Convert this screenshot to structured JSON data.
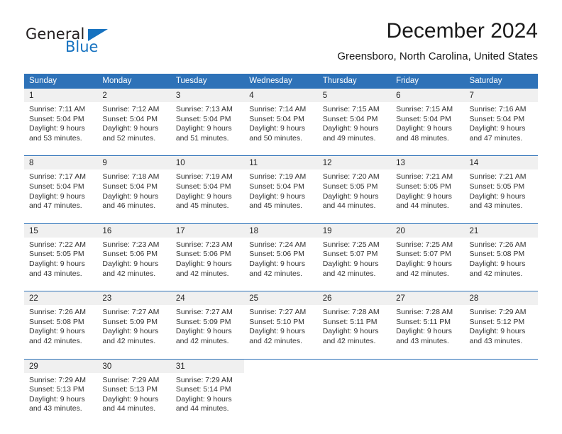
{
  "brand": {
    "name_top": "General",
    "name_bottom": "Blue",
    "triangle_icon": "triangle-icon",
    "color_blue": "#1672c0",
    "color_dark": "#231f20"
  },
  "header": {
    "title": "December 2024",
    "subtitle": "Greensboro, North Carolina, United States"
  },
  "theme": {
    "header_blue": "#2e72b8",
    "day_band_gray": "#f0f0f0",
    "text_color": "#222222"
  },
  "weekdays": [
    "Sunday",
    "Monday",
    "Tuesday",
    "Wednesday",
    "Thursday",
    "Friday",
    "Saturday"
  ],
  "weeks": [
    [
      {
        "day": "1",
        "sunrise": "Sunrise: 7:11 AM",
        "sunset": "Sunset: 5:04 PM",
        "daylight_1": "Daylight: 9 hours",
        "daylight_2": "and 53 minutes."
      },
      {
        "day": "2",
        "sunrise": "Sunrise: 7:12 AM",
        "sunset": "Sunset: 5:04 PM",
        "daylight_1": "Daylight: 9 hours",
        "daylight_2": "and 52 minutes."
      },
      {
        "day": "3",
        "sunrise": "Sunrise: 7:13 AM",
        "sunset": "Sunset: 5:04 PM",
        "daylight_1": "Daylight: 9 hours",
        "daylight_2": "and 51 minutes."
      },
      {
        "day": "4",
        "sunrise": "Sunrise: 7:14 AM",
        "sunset": "Sunset: 5:04 PM",
        "daylight_1": "Daylight: 9 hours",
        "daylight_2": "and 50 minutes."
      },
      {
        "day": "5",
        "sunrise": "Sunrise: 7:15 AM",
        "sunset": "Sunset: 5:04 PM",
        "daylight_1": "Daylight: 9 hours",
        "daylight_2": "and 49 minutes."
      },
      {
        "day": "6",
        "sunrise": "Sunrise: 7:15 AM",
        "sunset": "Sunset: 5:04 PM",
        "daylight_1": "Daylight: 9 hours",
        "daylight_2": "and 48 minutes."
      },
      {
        "day": "7",
        "sunrise": "Sunrise: 7:16 AM",
        "sunset": "Sunset: 5:04 PM",
        "daylight_1": "Daylight: 9 hours",
        "daylight_2": "and 47 minutes."
      }
    ],
    [
      {
        "day": "8",
        "sunrise": "Sunrise: 7:17 AM",
        "sunset": "Sunset: 5:04 PM",
        "daylight_1": "Daylight: 9 hours",
        "daylight_2": "and 47 minutes."
      },
      {
        "day": "9",
        "sunrise": "Sunrise: 7:18 AM",
        "sunset": "Sunset: 5:04 PM",
        "daylight_1": "Daylight: 9 hours",
        "daylight_2": "and 46 minutes."
      },
      {
        "day": "10",
        "sunrise": "Sunrise: 7:19 AM",
        "sunset": "Sunset: 5:04 PM",
        "daylight_1": "Daylight: 9 hours",
        "daylight_2": "and 45 minutes."
      },
      {
        "day": "11",
        "sunrise": "Sunrise: 7:19 AM",
        "sunset": "Sunset: 5:04 PM",
        "daylight_1": "Daylight: 9 hours",
        "daylight_2": "and 45 minutes."
      },
      {
        "day": "12",
        "sunrise": "Sunrise: 7:20 AM",
        "sunset": "Sunset: 5:05 PM",
        "daylight_1": "Daylight: 9 hours",
        "daylight_2": "and 44 minutes."
      },
      {
        "day": "13",
        "sunrise": "Sunrise: 7:21 AM",
        "sunset": "Sunset: 5:05 PM",
        "daylight_1": "Daylight: 9 hours",
        "daylight_2": "and 44 minutes."
      },
      {
        "day": "14",
        "sunrise": "Sunrise: 7:21 AM",
        "sunset": "Sunset: 5:05 PM",
        "daylight_1": "Daylight: 9 hours",
        "daylight_2": "and 43 minutes."
      }
    ],
    [
      {
        "day": "15",
        "sunrise": "Sunrise: 7:22 AM",
        "sunset": "Sunset: 5:05 PM",
        "daylight_1": "Daylight: 9 hours",
        "daylight_2": "and 43 minutes."
      },
      {
        "day": "16",
        "sunrise": "Sunrise: 7:23 AM",
        "sunset": "Sunset: 5:06 PM",
        "daylight_1": "Daylight: 9 hours",
        "daylight_2": "and 42 minutes."
      },
      {
        "day": "17",
        "sunrise": "Sunrise: 7:23 AM",
        "sunset": "Sunset: 5:06 PM",
        "daylight_1": "Daylight: 9 hours",
        "daylight_2": "and 42 minutes."
      },
      {
        "day": "18",
        "sunrise": "Sunrise: 7:24 AM",
        "sunset": "Sunset: 5:06 PM",
        "daylight_1": "Daylight: 9 hours",
        "daylight_2": "and 42 minutes."
      },
      {
        "day": "19",
        "sunrise": "Sunrise: 7:25 AM",
        "sunset": "Sunset: 5:07 PM",
        "daylight_1": "Daylight: 9 hours",
        "daylight_2": "and 42 minutes."
      },
      {
        "day": "20",
        "sunrise": "Sunrise: 7:25 AM",
        "sunset": "Sunset: 5:07 PM",
        "daylight_1": "Daylight: 9 hours",
        "daylight_2": "and 42 minutes."
      },
      {
        "day": "21",
        "sunrise": "Sunrise: 7:26 AM",
        "sunset": "Sunset: 5:08 PM",
        "daylight_1": "Daylight: 9 hours",
        "daylight_2": "and 42 minutes."
      }
    ],
    [
      {
        "day": "22",
        "sunrise": "Sunrise: 7:26 AM",
        "sunset": "Sunset: 5:08 PM",
        "daylight_1": "Daylight: 9 hours",
        "daylight_2": "and 42 minutes."
      },
      {
        "day": "23",
        "sunrise": "Sunrise: 7:27 AM",
        "sunset": "Sunset: 5:09 PM",
        "daylight_1": "Daylight: 9 hours",
        "daylight_2": "and 42 minutes."
      },
      {
        "day": "24",
        "sunrise": "Sunrise: 7:27 AM",
        "sunset": "Sunset: 5:09 PM",
        "daylight_1": "Daylight: 9 hours",
        "daylight_2": "and 42 minutes."
      },
      {
        "day": "25",
        "sunrise": "Sunrise: 7:27 AM",
        "sunset": "Sunset: 5:10 PM",
        "daylight_1": "Daylight: 9 hours",
        "daylight_2": "and 42 minutes."
      },
      {
        "day": "26",
        "sunrise": "Sunrise: 7:28 AM",
        "sunset": "Sunset: 5:11 PM",
        "daylight_1": "Daylight: 9 hours",
        "daylight_2": "and 42 minutes."
      },
      {
        "day": "27",
        "sunrise": "Sunrise: 7:28 AM",
        "sunset": "Sunset: 5:11 PM",
        "daylight_1": "Daylight: 9 hours",
        "daylight_2": "and 43 minutes."
      },
      {
        "day": "28",
        "sunrise": "Sunrise: 7:29 AM",
        "sunset": "Sunset: 5:12 PM",
        "daylight_1": "Daylight: 9 hours",
        "daylight_2": "and 43 minutes."
      }
    ],
    [
      {
        "day": "29",
        "sunrise": "Sunrise: 7:29 AM",
        "sunset": "Sunset: 5:13 PM",
        "daylight_1": "Daylight: 9 hours",
        "daylight_2": "and 43 minutes."
      },
      {
        "day": "30",
        "sunrise": "Sunrise: 7:29 AM",
        "sunset": "Sunset: 5:13 PM",
        "daylight_1": "Daylight: 9 hours",
        "daylight_2": "and 44 minutes."
      },
      {
        "day": "31",
        "sunrise": "Sunrise: 7:29 AM",
        "sunset": "Sunset: 5:14 PM",
        "daylight_1": "Daylight: 9 hours",
        "daylight_2": "and 44 minutes."
      },
      {
        "day": "",
        "sunrise": "",
        "sunset": "",
        "daylight_1": "",
        "daylight_2": ""
      },
      {
        "day": "",
        "sunrise": "",
        "sunset": "",
        "daylight_1": "",
        "daylight_2": ""
      },
      {
        "day": "",
        "sunrise": "",
        "sunset": "",
        "daylight_1": "",
        "daylight_2": ""
      },
      {
        "day": "",
        "sunrise": "",
        "sunset": "",
        "daylight_1": "",
        "daylight_2": ""
      }
    ]
  ]
}
